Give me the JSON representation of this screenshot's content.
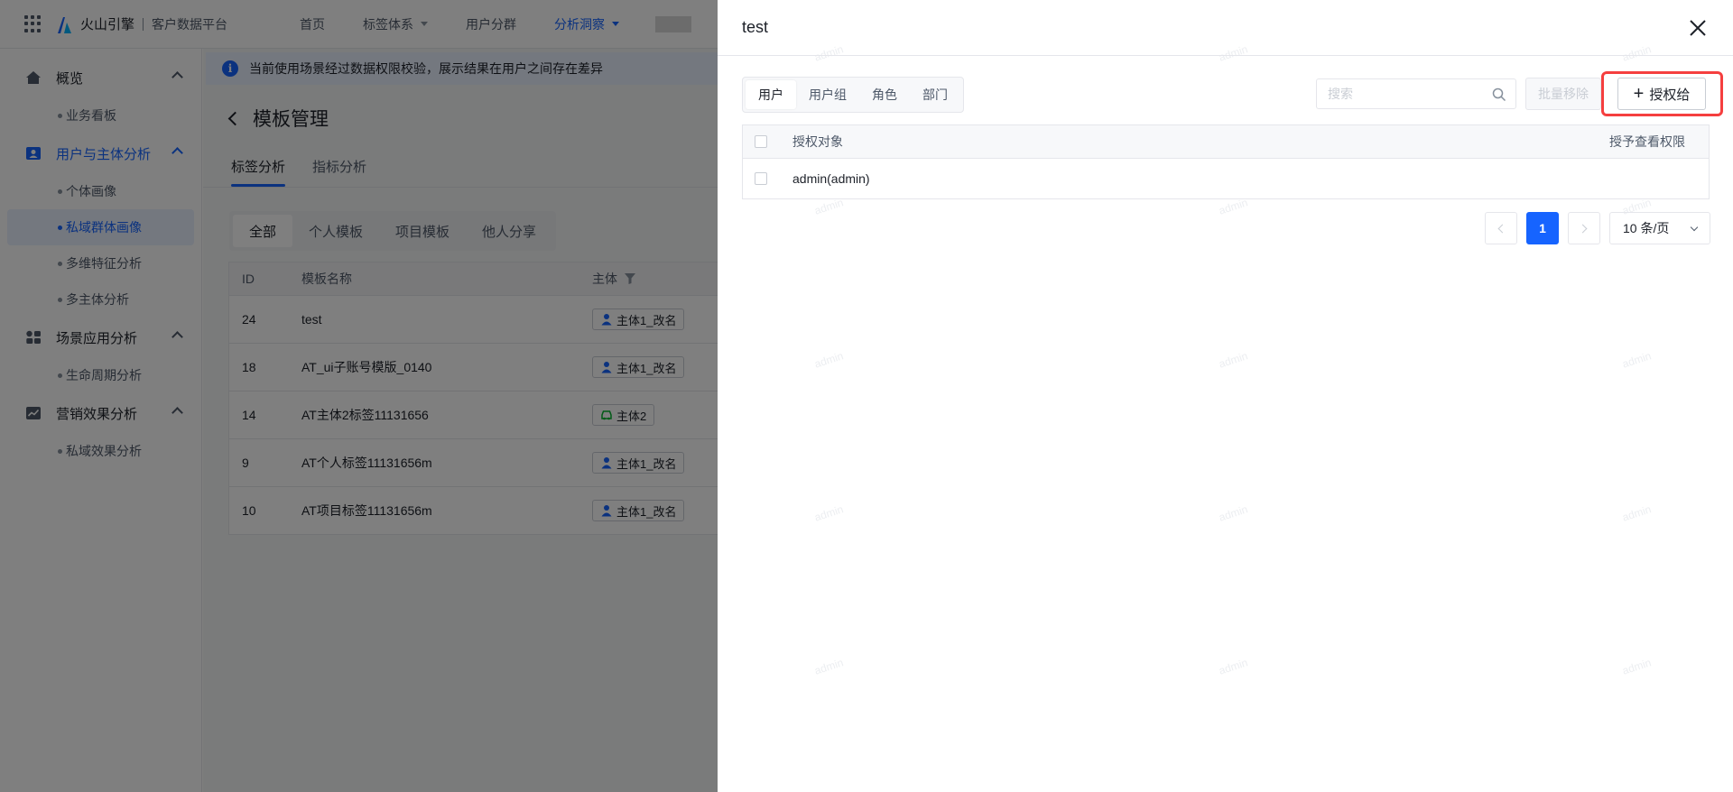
{
  "topbar": {
    "brand": "火山引擎",
    "platform": "客户数据平台",
    "nav": [
      {
        "label": "首页",
        "dropdown": false,
        "active": false
      },
      {
        "label": "标签体系",
        "dropdown": true,
        "active": false
      },
      {
        "label": "用户分群",
        "dropdown": false,
        "active": false
      },
      {
        "label": "分析洞察",
        "dropdown": true,
        "active": true
      }
    ]
  },
  "sidebar": {
    "groups": [
      {
        "label": "概览",
        "icon": "home-icon",
        "active": false,
        "items": [
          {
            "label": "业务看板",
            "active": false
          }
        ]
      },
      {
        "label": "用户与主体分析",
        "icon": "user-card-icon",
        "active": true,
        "items": [
          {
            "label": "个体画像",
            "active": false
          },
          {
            "label": "私域群体画像",
            "active": true
          },
          {
            "label": "多维特征分析",
            "active": false
          },
          {
            "label": "多主体分析",
            "active": false
          }
        ]
      },
      {
        "label": "场景应用分析",
        "icon": "apps-icon",
        "active": false,
        "items": [
          {
            "label": "生命周期分析",
            "active": false
          }
        ]
      },
      {
        "label": "营销效果分析",
        "icon": "chart-icon",
        "active": false,
        "items": [
          {
            "label": "私域效果分析",
            "active": false
          }
        ]
      }
    ]
  },
  "main": {
    "notice": "当前使用场景经过数据权限校验，展示结果在用户之间存在差异",
    "title": "模板管理",
    "tabs": [
      "标签分析",
      "指标分析"
    ],
    "segments": [
      "全部",
      "个人模板",
      "项目模板",
      "他人分享"
    ],
    "table": {
      "headers": [
        "ID",
        "模板名称",
        "主体"
      ],
      "rows": [
        {
          "id": "24",
          "name": "test",
          "subject": "主体1_改名",
          "subject_icon": "person-icon"
        },
        {
          "id": "18",
          "name": "AT_ui子账号模版_0140",
          "subject": "主体1_改名",
          "subject_icon": "person-icon"
        },
        {
          "id": "14",
          "name": "AT主体2标签11131656",
          "subject": "主体2",
          "subject_icon": "car-icon"
        },
        {
          "id": "9",
          "name": "AT个人标签11131656m",
          "subject": "主体1_改名",
          "subject_icon": "person-icon"
        },
        {
          "id": "10",
          "name": "AT项目标签11131656m",
          "subject": "主体1_改名",
          "subject_icon": "person-icon"
        }
      ]
    }
  },
  "drawer": {
    "title": "test",
    "segments": [
      "用户",
      "用户组",
      "角色",
      "部门"
    ],
    "search_placeholder": "搜索",
    "bulk_remove": "批量移除",
    "grant_button": "授权给",
    "table": {
      "headers": {
        "object": "授权对象",
        "permission": "授予查看权限"
      },
      "rows": [
        {
          "name": "admin(admin)",
          "view_permission": true
        }
      ]
    },
    "pagination": {
      "current": "1",
      "page_size": "10 条/页"
    },
    "watermark": "admin"
  },
  "colors": {
    "primary": "#1664ff",
    "highlight": "#f53f3f",
    "overlay": "rgba(0,0,0,0.5)"
  }
}
